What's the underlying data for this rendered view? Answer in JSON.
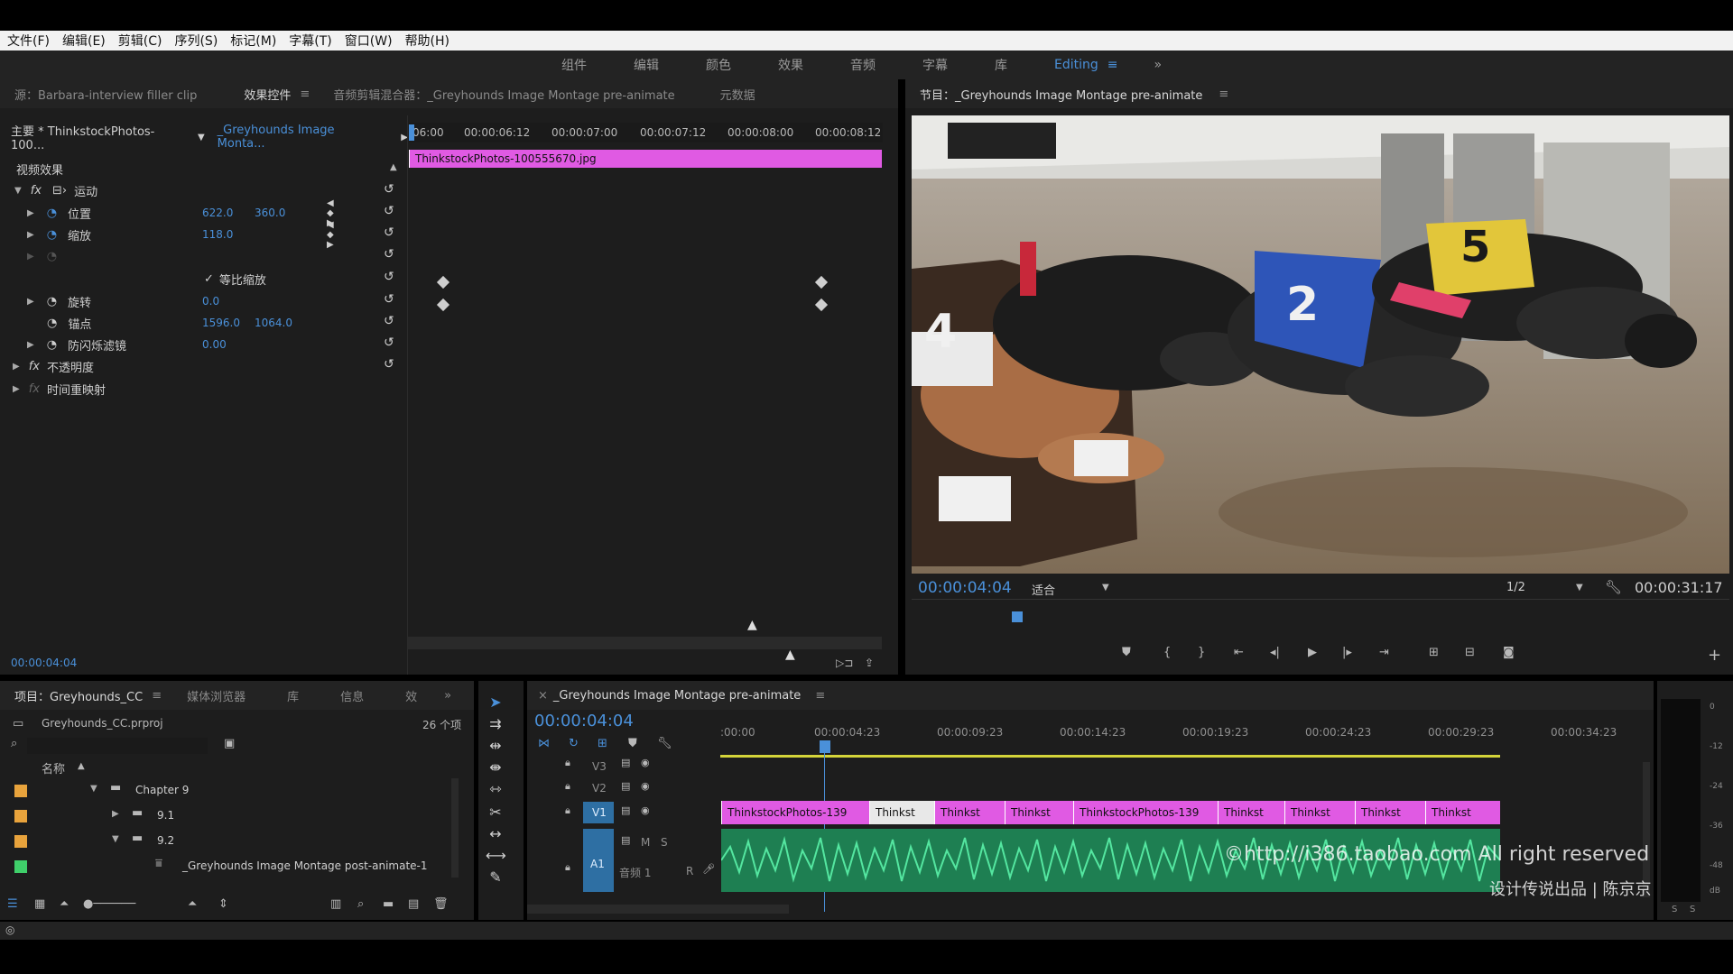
{
  "menu": [
    "文件(F)",
    "编辑(E)",
    "剪辑(C)",
    "序列(S)",
    "标记(M)",
    "字幕(T)",
    "窗口(W)",
    "帮助(H)"
  ],
  "workspaces": {
    "items": [
      "组件",
      "编辑",
      "颜色",
      "效果",
      "音频",
      "字幕",
      "库"
    ],
    "active": "Editing"
  },
  "source_tabs": {
    "source": "源：Barbara-interview filler clip",
    "effects": "效果控件",
    "audio_mixer": "音频剪辑混合器：_Greyhounds Image Montage pre-animate",
    "metadata": "元数据"
  },
  "effect_controls": {
    "master": "主要 * ThinkstockPhotos-100...",
    "sequence": "_Greyhounds Image Monta...",
    "timecodes": [
      "06:00",
      "00:00:06:12",
      "00:00:07:00",
      "00:00:07:12",
      "00:00:08:00",
      "00:00:08:12"
    ],
    "clip_name": "ThinkstockPhotos-100555670.jpg",
    "video_effects": "视频效果",
    "motion": "运动",
    "position": {
      "label": "位置",
      "x": "622.0",
      "y": "360.0"
    },
    "scale": {
      "label": "缩放",
      "value": "118.0"
    },
    "uniform_scale": "等比缩放",
    "rotation": {
      "label": "旋转",
      "value": "0.0"
    },
    "anchor": {
      "label": "锚点",
      "x": "1596.0",
      "y": "1064.0"
    },
    "antiflicker": {
      "label": "防闪烁滤镜",
      "value": "0.00"
    },
    "opacity": "不透明度",
    "time_remap": "时间重映射",
    "current_time": "00:00:04:04"
  },
  "program": {
    "title": "节目：_Greyhounds Image Montage pre-animate",
    "timecode": "00:00:04:04",
    "fit": "适合",
    "resolution": "1/2",
    "duration": "00:00:31:17",
    "dog_numbers": [
      "4",
      "2",
      "5"
    ]
  },
  "project": {
    "tabs": [
      "项目：Greyhounds_CC",
      "媒体浏览器",
      "库",
      "信息",
      "效"
    ],
    "file": "Greyhounds_CC.prproj",
    "count": "26 个项",
    "name_header": "名称",
    "items": [
      {
        "name": "Chapter 9",
        "color": "#e8a33c"
      },
      {
        "name": "9.1",
        "color": "#e8a33c"
      },
      {
        "name": "9.2",
        "color": "#e8a33c"
      },
      {
        "name": "_Greyhounds Image Montage post-animate-1",
        "color": "#3fcf6a"
      }
    ]
  },
  "timeline": {
    "title": "_Greyhounds Image Montage pre-animate",
    "timecode": "00:00:04:04",
    "ruler": [
      ":00:00",
      "00:00:04:23",
      "00:00:09:23",
      "00:00:14:23",
      "00:00:19:23",
      "00:00:24:23",
      "00:00:29:23",
      "00:00:34:23"
    ],
    "tracks": {
      "v3": "V3",
      "v2": "V2",
      "v1": "V1",
      "a1": "A1",
      "audio1": "音频 1",
      "m": "M",
      "s": "S",
      "r": "R"
    },
    "clips": [
      "ThinkstockPhotos-139",
      "Thinkst",
      "Thinkst",
      "Thinkst",
      "ThinkstockPhotos-139",
      "Thinkst",
      "Thinkst",
      "Thinkst",
      "Thinkst"
    ]
  },
  "meters": [
    "0",
    "-12",
    "-24",
    "-36",
    "-48",
    "dB"
  ],
  "meter_footer": [
    "S",
    "S"
  ],
  "watermark": {
    "line1": "©http://i386.taobao.com  All right reserved",
    "line2": "设计传说出品 | 陈京京"
  }
}
